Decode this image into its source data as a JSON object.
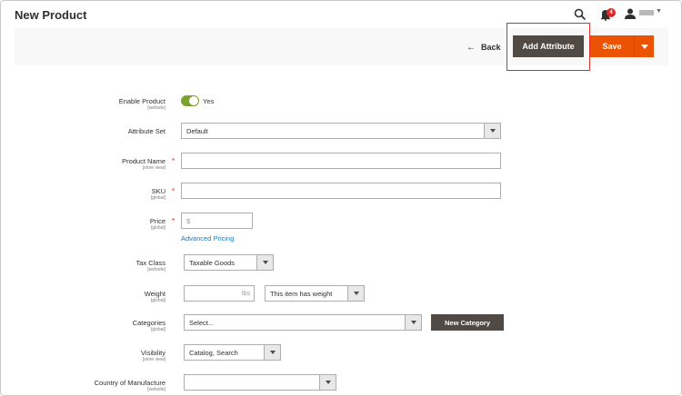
{
  "header": {
    "title": "New Product",
    "notifications_count": "4",
    "icons": [
      "search-icon",
      "bell-icon",
      "user-icon"
    ]
  },
  "toolbar": {
    "back_label": "Back",
    "add_attribute_label": "Add Attribute",
    "save_label": "Save"
  },
  "form": {
    "enable_product": {
      "label": "Enable Product",
      "scope": "[website]",
      "value": "Yes"
    },
    "attribute_set": {
      "label": "Attribute Set",
      "value": "Default"
    },
    "product_name": {
      "label": "Product Name",
      "scope": "[store view]",
      "value": ""
    },
    "sku": {
      "label": "SKU",
      "scope": "[global]",
      "value": ""
    },
    "price": {
      "label": "Price",
      "scope": "[global]",
      "currency": "$",
      "value": "",
      "advanced_link": "Advanced Pricing"
    },
    "tax_class": {
      "label": "Tax Class",
      "scope": "[website]",
      "value": "Taxable Goods"
    },
    "weight": {
      "label": "Weight",
      "scope": "[global]",
      "value": "",
      "unit": "lbs",
      "has_weight": "This item has weight"
    },
    "categories": {
      "label": "Categories",
      "scope": "[global]",
      "value": "Select...",
      "new_category_label": "New Category"
    },
    "visibility": {
      "label": "Visibility",
      "scope": "[store view]",
      "value": "Catalog, Search"
    },
    "country_of_manufacture": {
      "label": "Country of Manufacture",
      "scope": "[website]",
      "value": ""
    }
  },
  "colors": {
    "primary_button": "#514943",
    "save_button": "#eb5202",
    "highlight": "#e02b27",
    "toggle_on": "#79a22e",
    "link": "#1979c3"
  }
}
